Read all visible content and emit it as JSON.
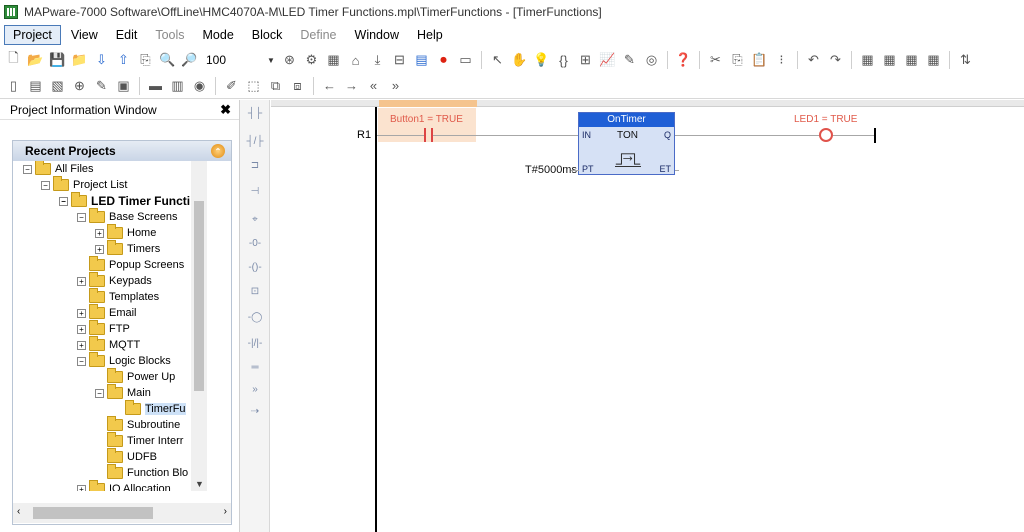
{
  "window": {
    "title": "MAPware-7000 Software\\OffLine\\HMC4070A-M\\LED Timer Functions.mpl\\TimerFunctions - [TimerFunctions]"
  },
  "menu": {
    "items": [
      {
        "label": "Project",
        "state": "active"
      },
      {
        "label": "View",
        "state": "normal"
      },
      {
        "label": "Edit",
        "state": "normal"
      },
      {
        "label": "Tools",
        "state": "disabled"
      },
      {
        "label": "Mode",
        "state": "normal"
      },
      {
        "label": "Block",
        "state": "normal"
      },
      {
        "label": "Define",
        "state": "disabled"
      },
      {
        "label": "Window",
        "state": "normal"
      },
      {
        "label": "Help",
        "state": "normal"
      }
    ]
  },
  "toolbar": {
    "zoom_value": "100"
  },
  "left_panel": {
    "title": "Project Information Window",
    "close_glyph": "✖",
    "recent_title": "Recent Projects",
    "tree": [
      {
        "label": "All Files",
        "indent": 0,
        "exp": "−"
      },
      {
        "label": "Project List",
        "indent": 1,
        "exp": "−"
      },
      {
        "label": "LED Timer Functi",
        "indent": 2,
        "exp": "−",
        "bold": true
      },
      {
        "label": "Base Screens",
        "indent": 3,
        "exp": "−"
      },
      {
        "label": "Home",
        "indent": 4,
        "exp": "+"
      },
      {
        "label": "Timers",
        "indent": 4,
        "exp": "+"
      },
      {
        "label": "Popup Screens",
        "indent": 3,
        "exp": ""
      },
      {
        "label": "Keypads",
        "indent": 3,
        "exp": "+"
      },
      {
        "label": "Templates",
        "indent": 3,
        "exp": ""
      },
      {
        "label": "Email",
        "indent": 3,
        "exp": "+"
      },
      {
        "label": "FTP",
        "indent": 3,
        "exp": "+"
      },
      {
        "label": "MQTT",
        "indent": 3,
        "exp": "+"
      },
      {
        "label": "Logic Blocks",
        "indent": 3,
        "exp": "−"
      },
      {
        "label": "Power Up",
        "indent": 4,
        "exp": ""
      },
      {
        "label": "Main",
        "indent": 4,
        "exp": "−"
      },
      {
        "label": "TimerFu",
        "indent": 5,
        "exp": "",
        "selected": true
      },
      {
        "label": "Subroutine",
        "indent": 4,
        "exp": ""
      },
      {
        "label": "Timer Interr",
        "indent": 4,
        "exp": ""
      },
      {
        "label": "UDFB",
        "indent": 4,
        "exp": ""
      },
      {
        "label": "Function Blo",
        "indent": 4,
        "exp": ""
      },
      {
        "label": "IO Allocation",
        "indent": 3,
        "exp": "+"
      }
    ]
  },
  "ladder": {
    "rung_label": "R1",
    "contact_label": "Button1 = TRUE",
    "coil_label": "LED1 = TRUE",
    "fb": {
      "name": "OnTimer",
      "type": "TON",
      "pin_in": "IN",
      "pin_q": "Q",
      "pin_pt": "PT",
      "pin_et": "ET"
    },
    "pt_value": "T#5000ms"
  }
}
